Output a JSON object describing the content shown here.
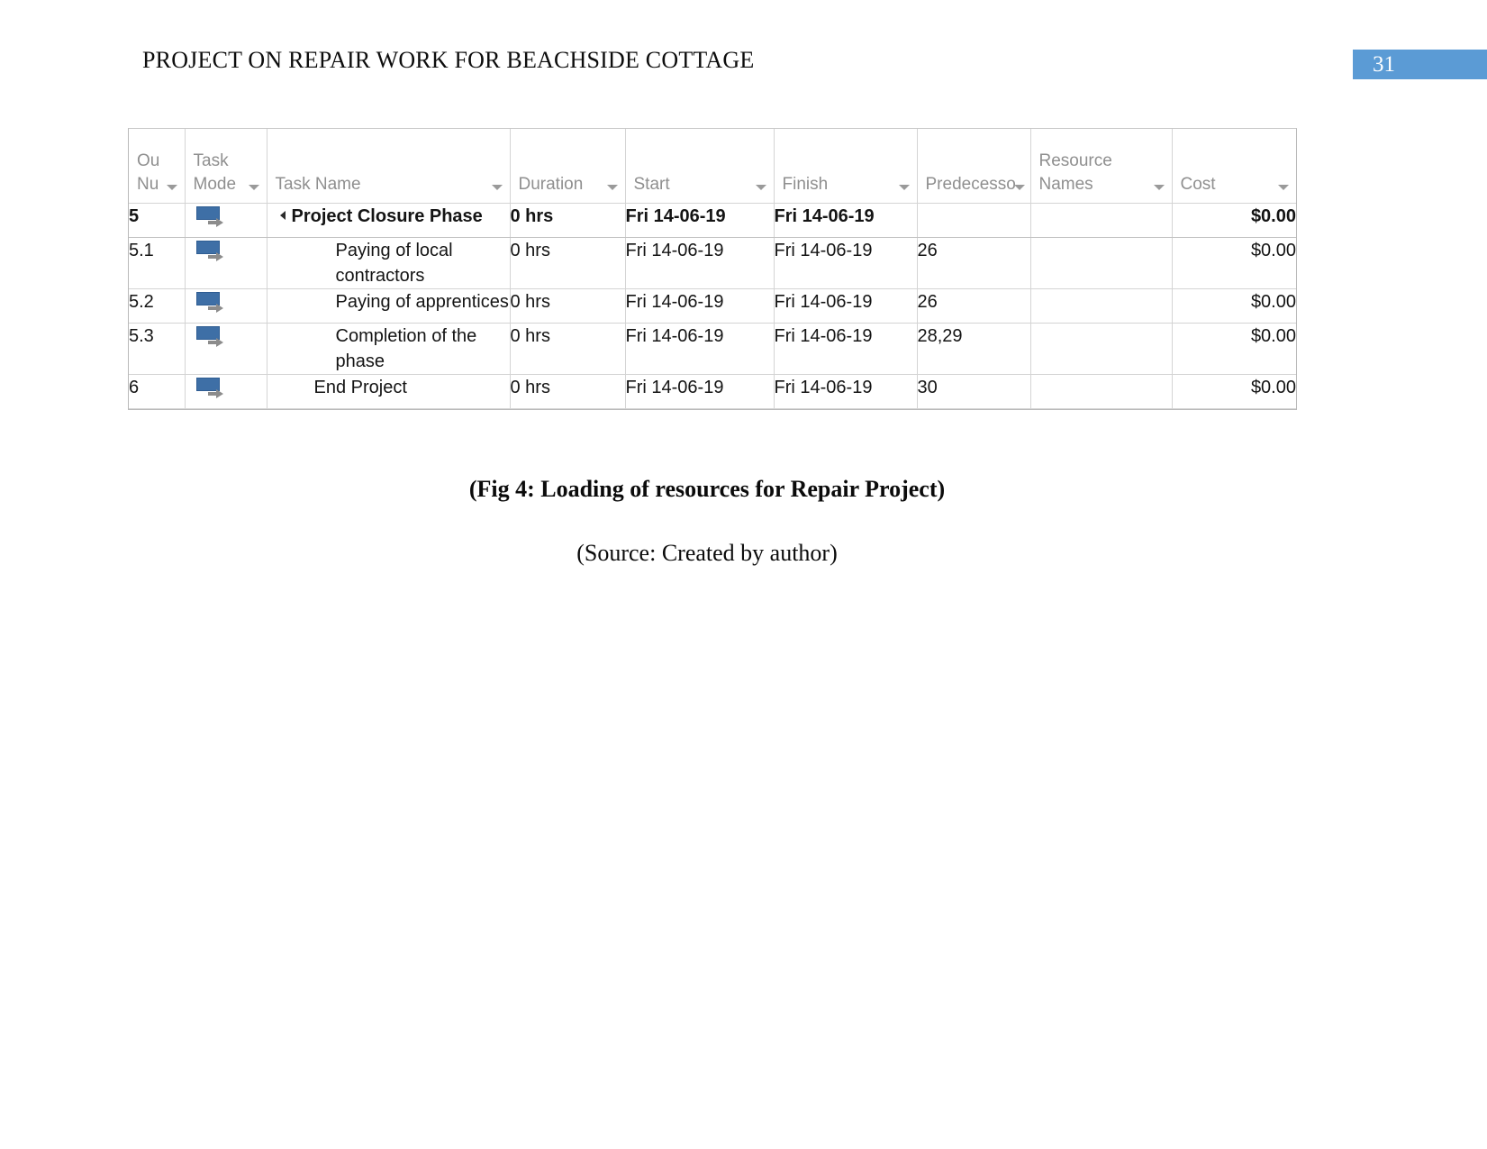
{
  "header": {
    "title": "PROJECT ON REPAIR WORK FOR BEACHSIDE COTTAGE",
    "page_number": "31",
    "badge_color": "#5b9bd5"
  },
  "table": {
    "columns": [
      {
        "label_line1": "Ou",
        "label_line2": "Nu",
        "has_filter": true
      },
      {
        "label_line1": "Task",
        "label_line2": "Mode",
        "has_filter": true
      },
      {
        "label_line1": "",
        "label_line2": "Task Name",
        "has_filter": true
      },
      {
        "label_line1": "",
        "label_line2": "Duration",
        "has_filter": true
      },
      {
        "label_line1": "",
        "label_line2": "Start",
        "has_filter": true
      },
      {
        "label_line1": "",
        "label_line2": "Finish",
        "has_filter": true
      },
      {
        "label_line1": "",
        "label_line2": "Predecesso",
        "has_filter": true
      },
      {
        "label_line1": "Resource",
        "label_line2": "Names",
        "has_filter": true
      },
      {
        "label_line1": "",
        "label_line2": "Cost",
        "has_filter": true
      }
    ],
    "rows": [
      {
        "outline": "5",
        "mode_icon": "auto-schedule-icon",
        "name": "Project Closure Phase",
        "duration": "0 hrs",
        "start": "Fri 14-06-19",
        "finish": "Fri 14-06-19",
        "predecessors": "",
        "resource_names": "",
        "cost": "$0.00",
        "summary": true,
        "indent": 0,
        "collapse_marker": true
      },
      {
        "outline": "5.1",
        "mode_icon": "auto-schedule-icon",
        "name": "Paying of local contractors",
        "duration": "0 hrs",
        "start": "Fri 14-06-19",
        "finish": "Fri 14-06-19",
        "predecessors": "26",
        "resource_names": "",
        "cost": "$0.00",
        "summary": false,
        "indent": 2,
        "collapse_marker": false
      },
      {
        "outline": "5.2",
        "mode_icon": "auto-schedule-icon",
        "name": "Paying of apprentices",
        "duration": "0 hrs",
        "start": "Fri 14-06-19",
        "finish": "Fri 14-06-19",
        "predecessors": "26",
        "resource_names": "",
        "cost": "$0.00",
        "summary": false,
        "indent": 2,
        "collapse_marker": false
      },
      {
        "outline": "5.3",
        "mode_icon": "auto-schedule-icon",
        "name": "Completion of the phase",
        "duration": "0 hrs",
        "start": "Fri 14-06-19",
        "finish": "Fri 14-06-19",
        "predecessors": "28,29",
        "resource_names": "",
        "cost": "$0.00",
        "summary": false,
        "indent": 2,
        "collapse_marker": false
      },
      {
        "outline": "6",
        "mode_icon": "auto-schedule-icon",
        "name": "End Project",
        "duration": "0 hrs",
        "start": "Fri 14-06-19",
        "finish": "Fri 14-06-19",
        "predecessors": "30",
        "resource_names": "",
        "cost": "$0.00",
        "summary": false,
        "indent": 1,
        "collapse_marker": false
      }
    ]
  },
  "caption": "(Fig 4: Loading of resources for Repair Project)",
  "source": "(Source: Created by author)"
}
